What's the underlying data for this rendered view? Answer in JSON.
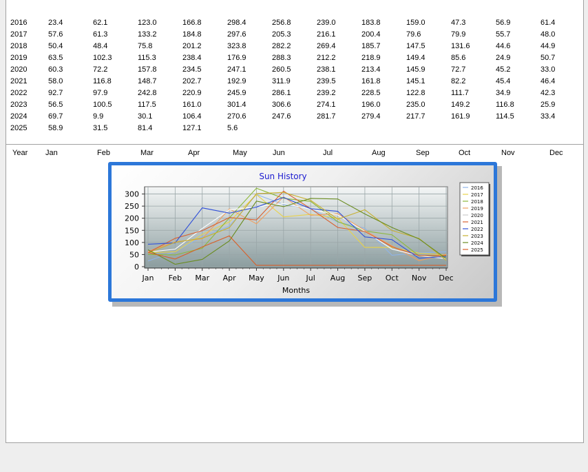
{
  "table": {
    "header": [
      "Year",
      "Jan",
      "Feb",
      "Mar",
      "Apr",
      "May",
      "Jun",
      "Jul",
      "Aug",
      "Sep",
      "Oct",
      "Nov",
      "Dec"
    ],
    "rows": [
      [
        "2016",
        "23.4",
        "62.1",
        "123.0",
        "166.8",
        "298.4",
        "256.8",
        "239.0",
        "183.8",
        "159.0",
        "47.3",
        "56.9",
        "61.4"
      ],
      [
        "2017",
        "57.6",
        "61.3",
        "133.2",
        "184.8",
        "297.6",
        "205.3",
        "216.1",
        "200.4",
        "79.6",
        "79.9",
        "55.7",
        "48.0"
      ],
      [
        "2018",
        "50.4",
        "48.4",
        "75.8",
        "201.2",
        "323.8",
        "282.2",
        "269.4",
        "185.7",
        "147.5",
        "131.6",
        "44.6",
        "44.9"
      ],
      [
        "2019",
        "63.5",
        "102.3",
        "115.3",
        "238.4",
        "176.9",
        "288.3",
        "212.2",
        "218.9",
        "149.4",
        "85.6",
        "24.9",
        "50.7"
      ],
      [
        "2020",
        "60.3",
        "72.2",
        "157.8",
        "234.5",
        "247.1",
        "260.5",
        "238.1",
        "213.4",
        "145.9",
        "72.7",
        "45.2",
        "33.0"
      ],
      [
        "2021",
        "58.0",
        "116.8",
        "148.7",
        "202.7",
        "192.9",
        "311.9",
        "239.5",
        "161.8",
        "145.1",
        "82.2",
        "45.4",
        "46.4"
      ],
      [
        "2022",
        "92.7",
        "97.9",
        "242.8",
        "220.9",
        "245.9",
        "286.1",
        "239.2",
        "228.5",
        "122.8",
        "111.7",
        "34.9",
        "42.3"
      ],
      [
        "2023",
        "56.5",
        "100.5",
        "117.5",
        "161.0",
        "301.4",
        "306.6",
        "274.1",
        "196.0",
        "235.0",
        "149.2",
        "116.8",
        "25.9"
      ],
      [
        "2024",
        "69.7",
        "9.9",
        "30.1",
        "106.4",
        "270.6",
        "247.6",
        "281.7",
        "279.4",
        "217.7",
        "161.9",
        "114.5",
        "33.4"
      ],
      [
        "2025",
        "58.9",
        "31.5",
        "81.4",
        "127.1",
        "5.6",
        "",
        "",
        "",
        "",
        "",
        "",
        ""
      ]
    ]
  },
  "chart_data": {
    "type": "line",
    "title": "Sun History",
    "xlabel": "Months",
    "ylabel": "",
    "categories": [
      "Jan",
      "Feb",
      "Mar",
      "Apr",
      "May",
      "Jun",
      "Jul",
      "Aug",
      "Sep",
      "Oct",
      "Nov",
      "Dec"
    ],
    "yticks": [
      0,
      50,
      100,
      150,
      200,
      250,
      300
    ],
    "ylim": [
      0,
      330
    ],
    "grid": true,
    "legend": "right",
    "series": [
      {
        "name": "2016",
        "color": "#8fb4e8",
        "values": [
          23.4,
          62.1,
          123.0,
          166.8,
          298.4,
          256.8,
          239.0,
          183.8,
          159.0,
          47.3,
          56.9,
          61.4
        ]
      },
      {
        "name": "2017",
        "color": "#e8d24a",
        "values": [
          57.6,
          61.3,
          133.2,
          184.8,
          297.6,
          205.3,
          216.1,
          200.4,
          79.6,
          79.9,
          55.7,
          48.0
        ]
      },
      {
        "name": "2018",
        "color": "#8cb83a",
        "values": [
          50.4,
          48.4,
          75.8,
          201.2,
          323.8,
          282.2,
          269.4,
          185.7,
          147.5,
          131.6,
          44.6,
          44.9
        ]
      },
      {
        "name": "2019",
        "color": "#f0a060",
        "values": [
          63.5,
          102.3,
          115.3,
          238.4,
          176.9,
          288.3,
          212.2,
          218.9,
          149.4,
          85.6,
          24.9,
          50.7
        ]
      },
      {
        "name": "2020",
        "color": "#ffffff",
        "values": [
          60.3,
          72.2,
          157.8,
          234.5,
          247.1,
          260.5,
          238.1,
          213.4,
          145.9,
          72.7,
          45.2,
          33.0
        ]
      },
      {
        "name": "2021",
        "color": "#d86030",
        "values": [
          58.0,
          116.8,
          148.7,
          202.7,
          192.9,
          311.9,
          239.5,
          161.8,
          145.1,
          82.2,
          45.4,
          46.4
        ]
      },
      {
        "name": "2022",
        "color": "#3050d8",
        "values": [
          92.7,
          97.9,
          242.8,
          220.9,
          245.9,
          286.1,
          239.2,
          228.5,
          122.8,
          111.7,
          34.9,
          42.3
        ]
      },
      {
        "name": "2023",
        "color": "#c8b030",
        "values": [
          56.5,
          100.5,
          117.5,
          161.0,
          301.4,
          306.6,
          274.1,
          196.0,
          235.0,
          149.2,
          116.8,
          25.9
        ]
      },
      {
        "name": "2024",
        "color": "#6a8c20",
        "values": [
          69.7,
          9.9,
          30.1,
          106.4,
          270.6,
          247.6,
          281.7,
          279.4,
          217.7,
          161.9,
          114.5,
          33.4
        ]
      },
      {
        "name": "2025",
        "color": "#d8602a",
        "values": [
          58.9,
          31.5,
          81.4,
          127.1,
          5.6,
          5.6,
          5.6,
          5.6,
          5.6,
          5.6,
          5.6,
          5.6
        ]
      }
    ],
    "colors": {
      "title": "#1a1ad0",
      "frame": "#2c77d9"
    }
  }
}
